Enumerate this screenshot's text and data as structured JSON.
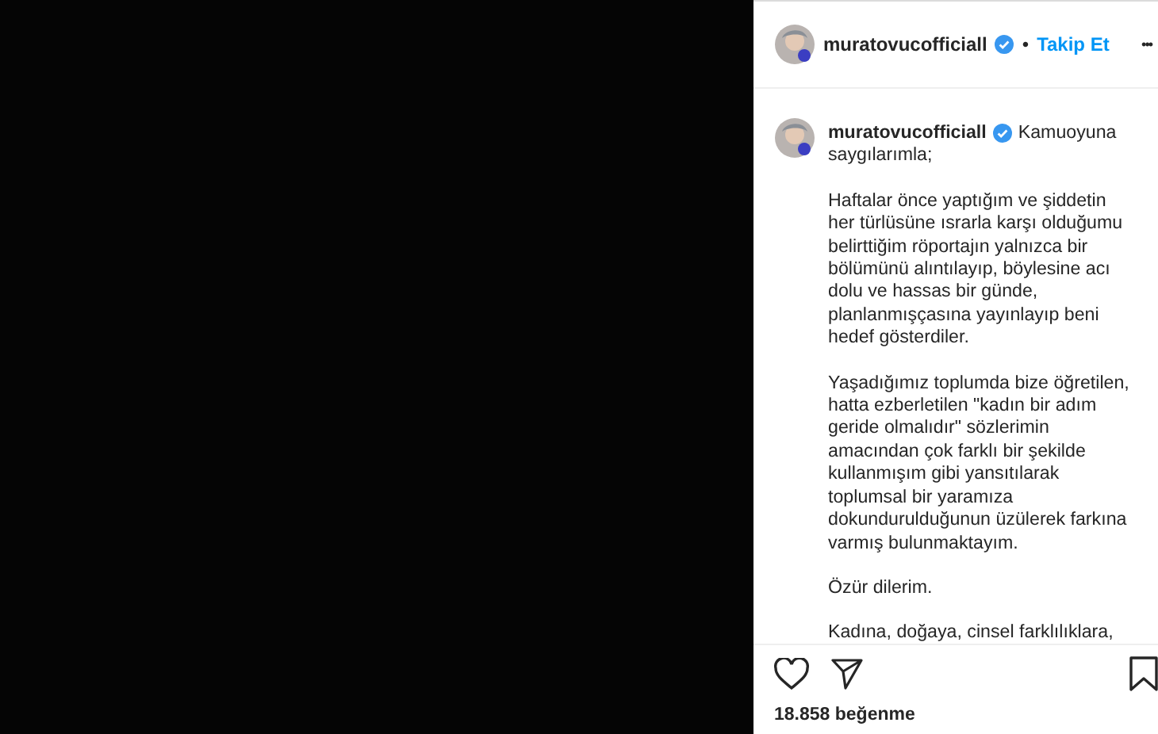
{
  "header": {
    "username": "muratovucofficiall",
    "verified": true,
    "separator": "•",
    "follow_label": "Takip Et",
    "more_label": "•••"
  },
  "caption": {
    "username": "muratovucofficiall",
    "verified": true,
    "paragraphs": [
      "Kamuoyuna\nsaygılarımla;",
      "Haftalar önce yaptığım ve şiddetin\nher türlüsüne ısrarla karşı olduğumu\nbelirttiğim röportajın yalnızca bir\nbölümünü alıntılayıp, böylesine acı\ndolu ve hassas bir günde,\nplanlanmışçasına yayınlayıp beni\nhedef gösterdiler.",
      "Yaşadığımız toplumda bize öğretilen,\nhatta ezberletilen \"kadın bir adım\ngeride olmalıdır\" sözlerimin\namacından çok farklı bir şekilde\nkullanmışım gibi yansıtılarak\ntoplumsal bir yaramıza\ndokundurulduğunun üzülerek farkına\nvarmış bulunmaktayım.",
      "Özür dilerim.",
      "Kadına, doğaya, cinsel farklılıklara,"
    ]
  },
  "likes": "18.858 beğenme"
}
